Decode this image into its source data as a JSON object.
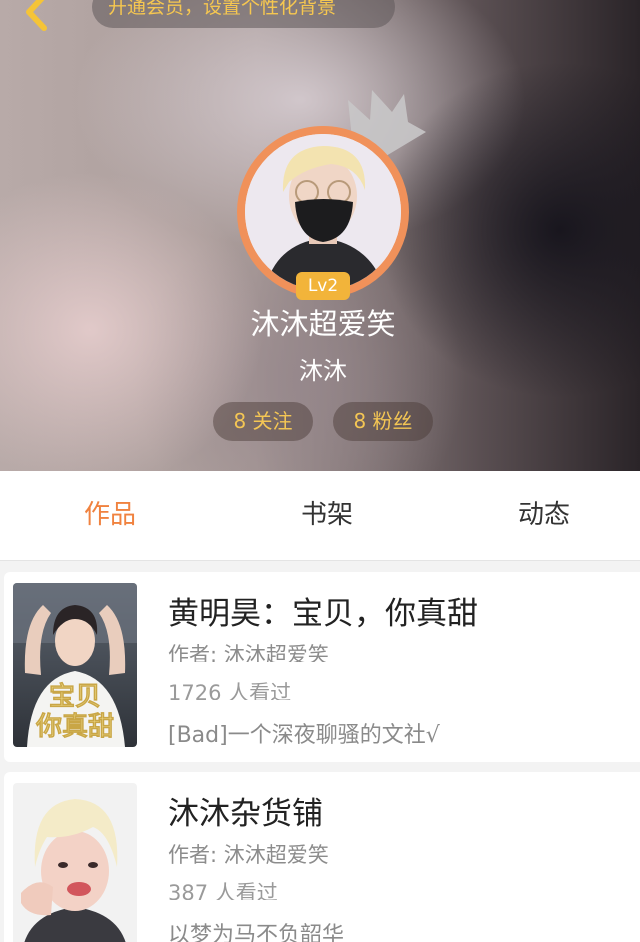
{
  "header": {
    "vip_banner": "开通会员，设置个性化背景",
    "level": "Lv2",
    "username": "沐沐超爱笑",
    "nickname": "沐沐",
    "following_label": "8 关注",
    "fans_label": "8 粉丝"
  },
  "tabs": [
    {
      "label": "作品",
      "active": true
    },
    {
      "label": "书架",
      "active": false
    },
    {
      "label": "动态",
      "active": false
    }
  ],
  "works": [
    {
      "title": "黄明昊：宝贝，你真甜",
      "author": "作者: 沐沐超爱笑",
      "reads": "1726 人看过",
      "description": "[Bad]一个深夜聊骚的文社√",
      "cover_text": "宝贝你真甜"
    },
    {
      "title": "沐沐杂货铺",
      "author": "作者: 沐沐超爱笑",
      "reads": "387 人看过",
      "description": "以梦为马不负韶华"
    }
  ],
  "colors": {
    "accent": "#f0823f",
    "gold": "#f4c654",
    "avatar_ring": "#f0915a",
    "level_badge": "#f2b43a"
  },
  "icons": [
    "back-arrow-icon",
    "crown-icon"
  ]
}
